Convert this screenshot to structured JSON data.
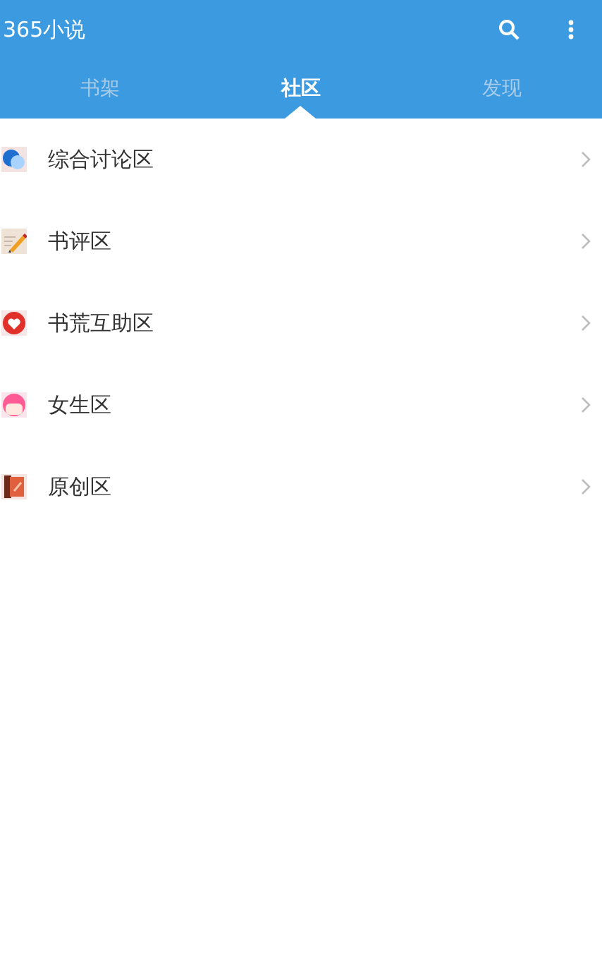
{
  "app_bar": {
    "title": "365小说"
  },
  "tabs": [
    {
      "label": "书架",
      "selected": false
    },
    {
      "label": "社区",
      "selected": true
    },
    {
      "label": "发现",
      "selected": false
    }
  ],
  "forums": [
    {
      "label": "综合讨论区",
      "kind": "chat"
    },
    {
      "label": "书评区",
      "kind": "review"
    },
    {
      "label": "书荒互助区",
      "kind": "heart"
    },
    {
      "label": "女生区",
      "kind": "girl"
    },
    {
      "label": "原创区",
      "kind": "book"
    }
  ]
}
